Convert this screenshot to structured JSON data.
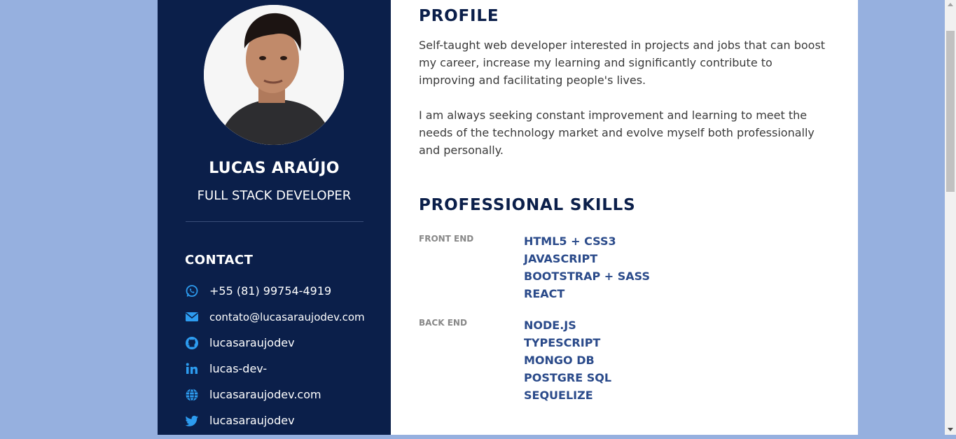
{
  "sidebar": {
    "name": "LUCAS ARAÚJO",
    "role": "FULL STACK DEVELOPER",
    "contact_title": "CONTACT",
    "contacts": [
      {
        "icon": "whatsapp-icon",
        "text": "+55 (81) 99754-4919"
      },
      {
        "icon": "email-icon",
        "text": "contato@lucasaraujodev.com"
      },
      {
        "icon": "github-icon",
        "text": "lucasaraujodev"
      },
      {
        "icon": "linkedin-icon",
        "text": "lucas-dev-"
      },
      {
        "icon": "globe-icon",
        "text": "lucasaraujodev.com"
      },
      {
        "icon": "twitter-icon",
        "text": "lucasaraujodev"
      }
    ]
  },
  "main": {
    "profile_title": "PROFILE",
    "profile_paragraphs": [
      "Self-taught web developer interested in projects and jobs that can boost my career, increase my learning and significantly contribute to improving and facilitating people's lives.",
      "I am always seeking constant improvement and learning to meet the needs of the technology market and evolve myself both professionally and personally."
    ],
    "skills_title": "PROFESSIONAL SKILLS",
    "skill_groups": [
      {
        "label": "FRONT END",
        "items": [
          "HTML5 + CSS3",
          "JAVASCRIPT",
          "BOOTSTRAP + SASS",
          "REACT"
        ]
      },
      {
        "label": "BACK END",
        "items": [
          "NODE.JS",
          "TYPESCRIPT",
          "MONGO DB",
          "POSTGRE SQL",
          "SEQUELIZE"
        ]
      }
    ]
  },
  "colors": {
    "background": "#96b0df",
    "sidebar": "#0b1f4a",
    "accent_icon": "#2d9cf0",
    "skill_text": "#2a4a8a",
    "heading": "#0b1f4a"
  }
}
